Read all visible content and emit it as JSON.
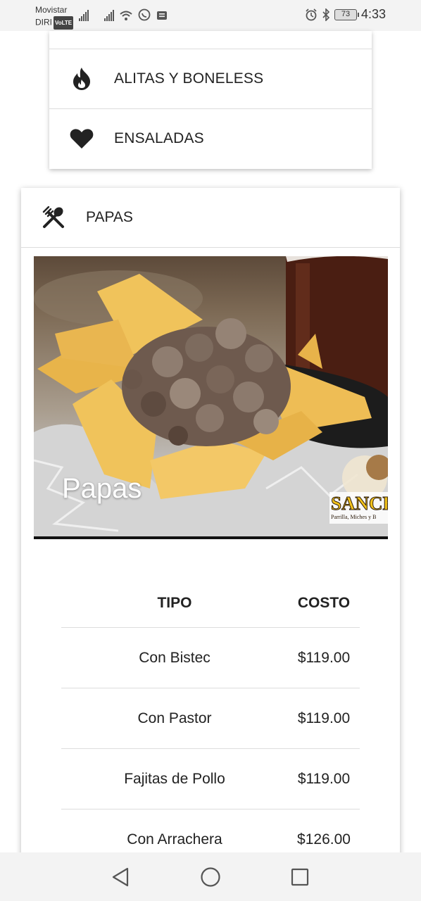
{
  "status_bar": {
    "carrier_line1": "Movistar",
    "carrier_line2": "DIRI",
    "volte_badge": "VoLTE",
    "battery_level": "73",
    "time": "4:33"
  },
  "categories": [
    {
      "label": "ALITAS Y BONELESS",
      "icon": "flame-icon"
    },
    {
      "label": "ENSALADAS",
      "icon": "heart-icon"
    }
  ],
  "papas": {
    "header_label": "PAPAS",
    "header_icon": "utensils-icon",
    "photo_caption": "Papas",
    "logo_text": "SANCH",
    "logo_subtext": "Parrilla, Miches y B",
    "table": {
      "headers": [
        "TIPO",
        "COSTO"
      ],
      "rows": [
        [
          "Con Bistec",
          "$119.00"
        ],
        [
          "Con Pastor",
          "$119.00"
        ],
        [
          "Fajitas de Pollo",
          "$119.00"
        ],
        [
          "Con Arrachera",
          "$126.00"
        ]
      ]
    }
  }
}
